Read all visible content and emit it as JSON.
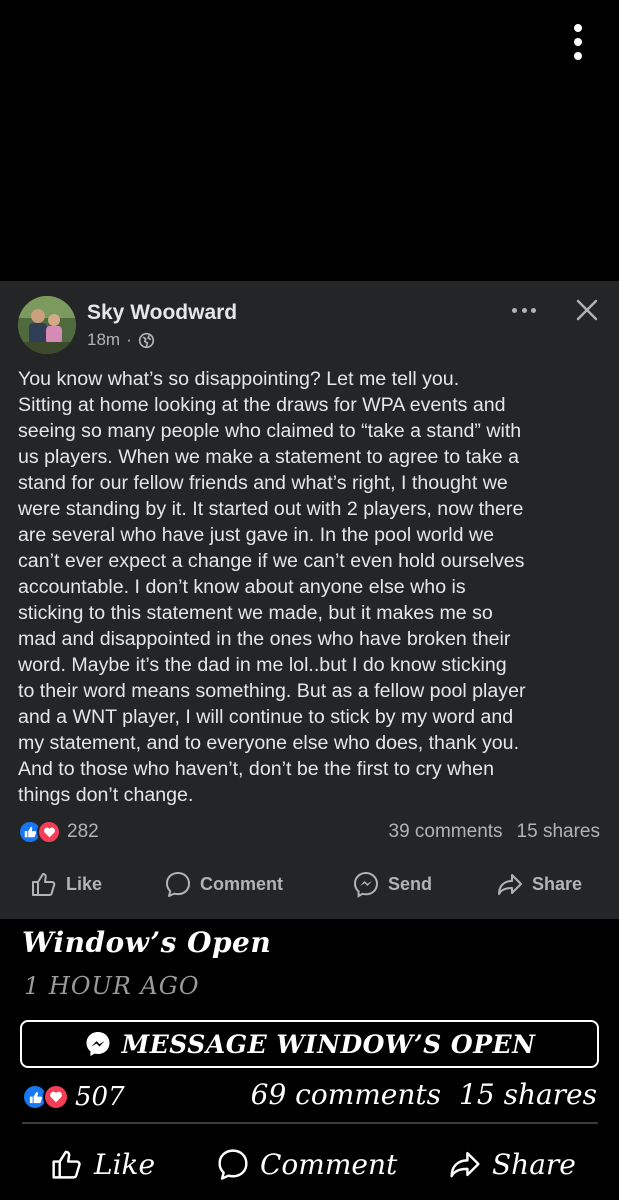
{
  "post": {
    "author": "Sky Woodward",
    "time": "18m",
    "separator": "·",
    "body": "You know what’s so disappointing? Let me tell you.\nSitting at home looking at the draws for WPA events and\nseeing so many people who claimed to “take a stand” with\nus players. When we make a statement to agree to take a\nstand for our fellow friends and what’s right, I thought we\nwere standing by it. It started out with 2 players, now there\nare several who have just gave in. In the pool world we\ncan’t ever expect a change if we can’t even hold ourselves\naccountable. I don’t know about anyone else who is\nsticking to this statement we made, but it makes me so\nmad and disappointed in the ones who have broken their\nword. Maybe it’s the dad in me lol..but I do know sticking\nto their word means something. But as a fellow pool player\nand a WNT player, I will continue to stick by my word and\nmy statement, and to everyone else who does, thank you.\nAnd to those who haven’t, don’t be the first to cry when\nthings don’t change.",
    "reaction_count": "282",
    "comments": "39 comments",
    "shares": "15 shares",
    "actions": {
      "like": "Like",
      "comment": "Comment",
      "send": "Send",
      "share": "Share"
    }
  },
  "overlay": {
    "title": "Window’s Open",
    "time": "1 HOUR AGO",
    "message_button": "MESSAGE WINDOW’S OPEN",
    "reaction_count": "507",
    "comments": "69 comments",
    "shares": "15 shares",
    "actions": {
      "like": "Like",
      "comment": "Comment",
      "share": "Share"
    }
  },
  "icons": {
    "top_menu": "vertical-dots-icon",
    "post_menu": "horizontal-dots-icon",
    "close": "close-icon",
    "privacy": "globe-icon",
    "like": "thumbs-up-icon",
    "love": "heart-icon",
    "comment": "speech-bubble-icon",
    "send": "messenger-icon",
    "share": "share-arrow-icon"
  },
  "colors": {
    "card_bg": "#242526",
    "primary_text": "#e4e6eb",
    "secondary_text": "#b0b3b8",
    "like_blue": "#1877f2",
    "love_red": "#f33e58"
  }
}
